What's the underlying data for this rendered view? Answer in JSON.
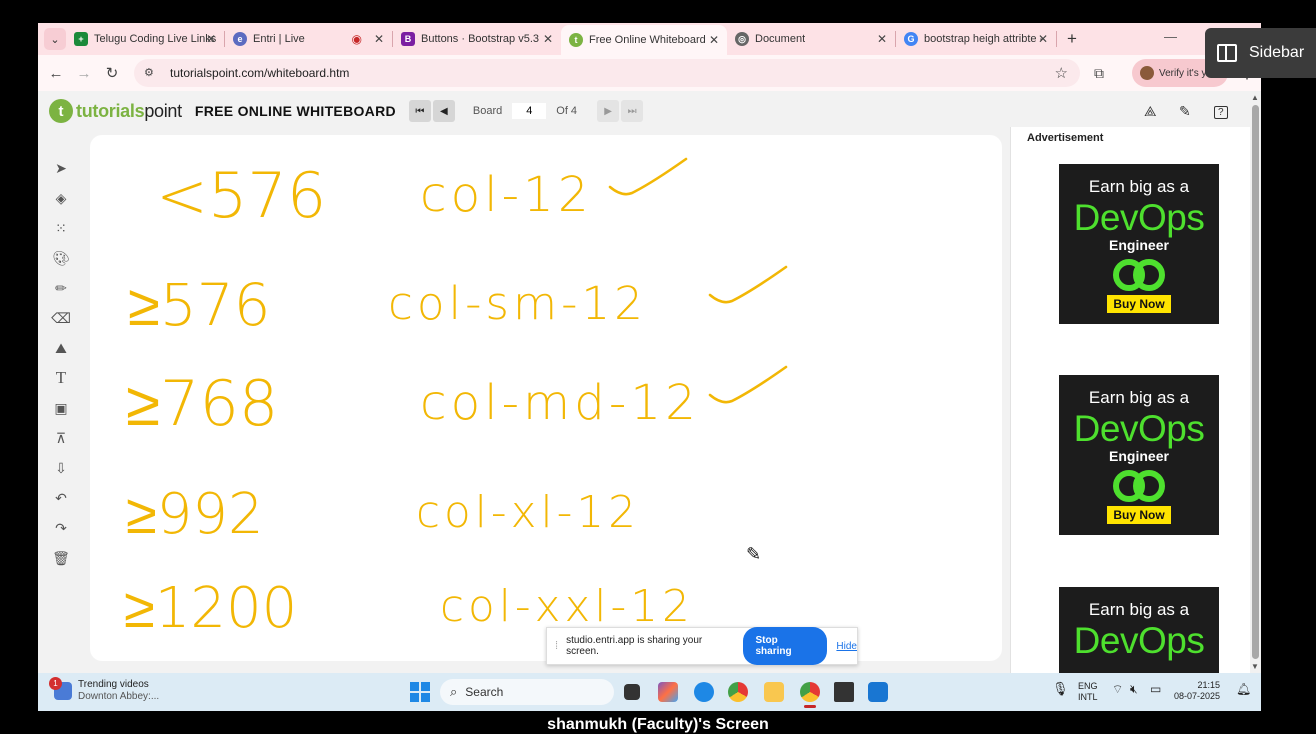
{
  "browser": {
    "tabs": [
      {
        "title": "Telugu Coding Live Links S",
        "favicon_color": "#1b8a3a",
        "favicon_glyph": "+",
        "active": false
      },
      {
        "title": "Entri | Live",
        "favicon_color": "#5c6bc0",
        "favicon_glyph": "e",
        "active": false
      },
      {
        "title": "Buttons · Bootstrap v5.3",
        "favicon_color": "#7b1fa2",
        "favicon_glyph": "B",
        "active": false
      },
      {
        "title": "Free Online Whiteboard",
        "favicon_color": "#7cb342",
        "favicon_glyph": "t",
        "active": true
      },
      {
        "title": "Document",
        "favicon_color": "#555555",
        "favicon_glyph": "◎",
        "active": false
      },
      {
        "title": "bootstrap heigh attribte - V",
        "favicon_color": "#4285f4",
        "favicon_glyph": "G",
        "active": false
      }
    ],
    "url": "tutorialspoint.com/whiteboard.htm",
    "profile_label": "Verify it's you"
  },
  "whiteboard": {
    "brand": "tutorialspoint",
    "brand_prefix": "tutorials",
    "brand_suffix": "point",
    "title": "FREE ONLINE WHITEBOARD",
    "board_label": "Board",
    "board_value": "4",
    "of_label": "Of 4",
    "tools": [
      "pointer-icon",
      "layers-add-icon",
      "grid-icon",
      "palette-icon",
      "pencil-icon",
      "eraser-icon",
      "fill-icon",
      "text-icon",
      "image-icon",
      "presentation-icon",
      "download-icon",
      "undo-icon",
      "redo-icon",
      "trash-icon"
    ],
    "ink_color": "#f2b705"
  },
  "handwriting": [
    {
      "breakpoint": "<576",
      "class": "col-12",
      "check": true
    },
    {
      "breakpoint": "≥576",
      "class": "col-sm-12",
      "check": true
    },
    {
      "breakpoint": "≥768",
      "class": "col-md-12",
      "check": true
    },
    {
      "breakpoint": "≥992",
      "class": "col-xl-12",
      "check": false
    },
    {
      "breakpoint": "≥1200",
      "class": "col-xxl-12",
      "check": false
    }
  ],
  "share_bar": {
    "message": "studio.entri.app is sharing your screen.",
    "stop_label": "Stop sharing",
    "hide_label": "Hide"
  },
  "ads": {
    "label": "Advertisement",
    "line1": "Earn big as a",
    "line2": "DevOps",
    "line3": "Engineer",
    "cta": "Buy Now"
  },
  "taskbar": {
    "trending_title": "Trending videos",
    "trending_sub": "Downton Abbey:...",
    "trending_badge": "1",
    "search_label": "Search",
    "lang_top": "ENG",
    "lang_bottom": "INTL",
    "time": "21:15",
    "date": "08-07-2025"
  },
  "overlay": {
    "sidebar_label": "Sidebar",
    "caption": "shanmukh (Faculty)'s Screen"
  }
}
